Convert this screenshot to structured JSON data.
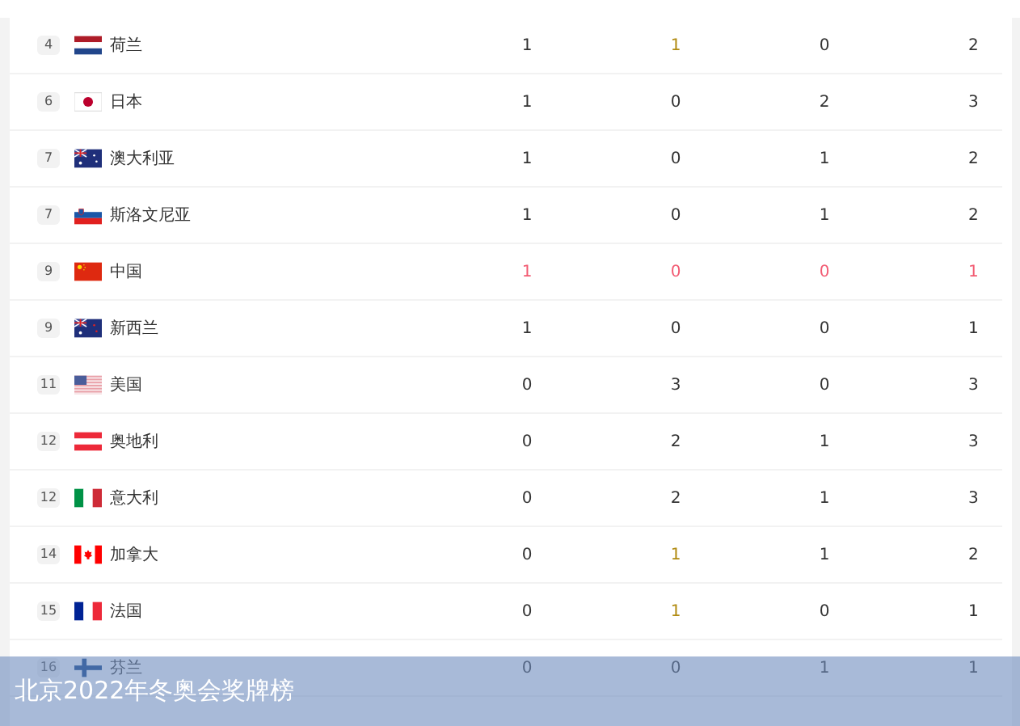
{
  "rows": [
    {
      "rank": "4",
      "kind": "nl",
      "name": "荷兰",
      "gold": "1",
      "silver": "1",
      "bronze": "0",
      "total": "2",
      "highlighted": false,
      "silver_accent": true
    },
    {
      "rank": "6",
      "kind": "jp",
      "name": "日本",
      "gold": "1",
      "silver": "0",
      "bronze": "2",
      "total": "3",
      "highlighted": false,
      "silver_accent": false
    },
    {
      "rank": "7",
      "kind": "au",
      "name": "澳大利亚",
      "gold": "1",
      "silver": "0",
      "bronze": "1",
      "total": "2",
      "highlighted": false,
      "silver_accent": false
    },
    {
      "rank": "7",
      "kind": "si",
      "name": "斯洛文尼亚",
      "gold": "1",
      "silver": "0",
      "bronze": "1",
      "total": "2",
      "highlighted": false,
      "silver_accent": false
    },
    {
      "rank": "9",
      "kind": "cn",
      "name": "中国",
      "gold": "1",
      "silver": "0",
      "bronze": "0",
      "total": "1",
      "highlighted": true,
      "silver_accent": false
    },
    {
      "rank": "9",
      "kind": "nz",
      "name": "新西兰",
      "gold": "1",
      "silver": "0",
      "bronze": "0",
      "total": "1",
      "highlighted": false,
      "silver_accent": false
    },
    {
      "rank": "11",
      "kind": "us",
      "name": "美国",
      "gold": "0",
      "silver": "3",
      "bronze": "0",
      "total": "3",
      "highlighted": false,
      "silver_accent": false
    },
    {
      "rank": "12",
      "kind": "at",
      "name": "奥地利",
      "gold": "0",
      "silver": "2",
      "bronze": "1",
      "total": "3",
      "highlighted": false,
      "silver_accent": false
    },
    {
      "rank": "12",
      "kind": "it",
      "name": "意大利",
      "gold": "0",
      "silver": "2",
      "bronze": "1",
      "total": "3",
      "highlighted": false,
      "silver_accent": false
    },
    {
      "rank": "14",
      "kind": "ca",
      "name": "加拿大",
      "gold": "0",
      "silver": "1",
      "bronze": "1",
      "total": "2",
      "highlighted": false,
      "silver_accent": true
    },
    {
      "rank": "15",
      "kind": "fr",
      "name": "法国",
      "gold": "0",
      "silver": "1",
      "bronze": "0",
      "total": "1",
      "highlighted": false,
      "silver_accent": true
    },
    {
      "rank": "16",
      "kind": "fi",
      "name": "芬兰",
      "gold": "0",
      "silver": "0",
      "bronze": "1",
      "total": "1",
      "highlighted": false,
      "silver_accent": false
    }
  ],
  "caption": "北京2022年冬奥会奖牌榜"
}
